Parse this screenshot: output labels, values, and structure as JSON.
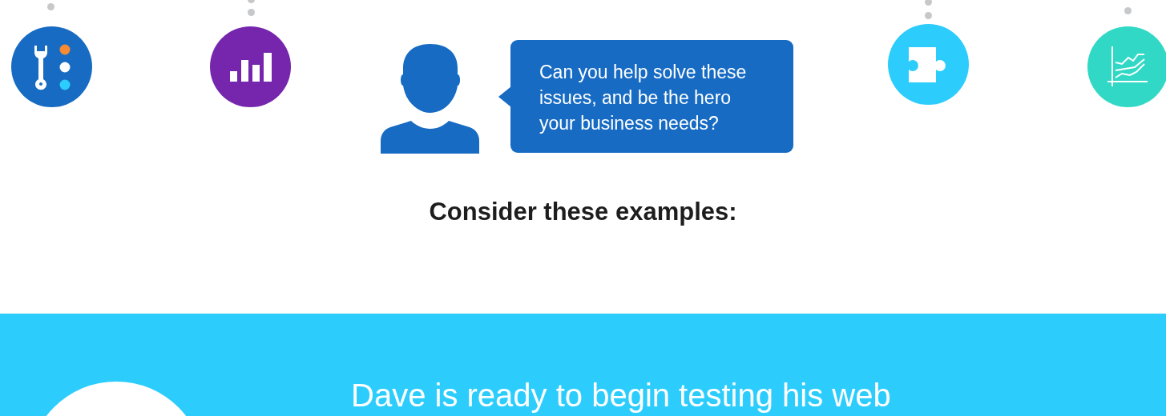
{
  "speech_bubble": {
    "text": "Can you help solve these issues, and be the hero your business needs?"
  },
  "heading": "Consider these examples:",
  "banner": {
    "headline": "Dave is ready to begin testing his web"
  }
}
